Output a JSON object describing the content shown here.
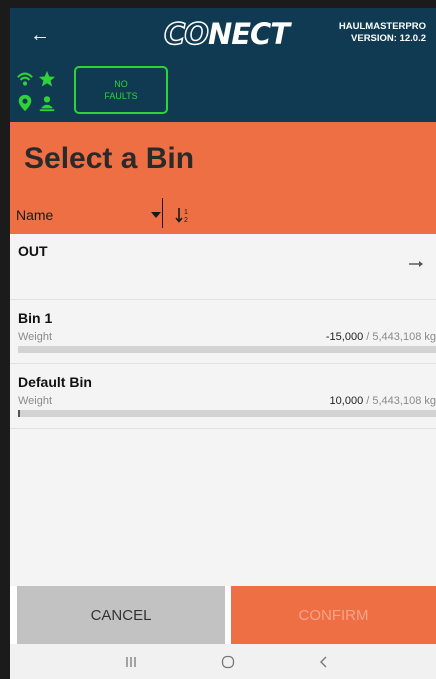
{
  "header": {
    "back_icon": "back-arrow-icon",
    "logo_prefix": "CO",
    "logo_suffix": "NECT",
    "app_name": "HAULMASTERPRO",
    "version": "VERSION: 12.0.2",
    "bg_color": "#103a52"
  },
  "status": {
    "icons": [
      "wifi-icon",
      "star-icon",
      "location-pin-icon",
      "person-icon"
    ],
    "icon_color": "#2fd238",
    "faults_label": "NO\nFAULTS"
  },
  "page": {
    "title": "Select a Bin",
    "accent_color": "#ef6f45"
  },
  "sort": {
    "field": "Name",
    "direction_icon": "sort-ascending-icon"
  },
  "bins": [
    {
      "name": "OUT",
      "action_icon": "arrow-right-icon"
    },
    {
      "name": "Bin 1",
      "weight_label": "Weight",
      "current": "-15,000",
      "capacity": "/ 5,443,108 kg",
      "fill_fraction": 0
    },
    {
      "name": "Default Bin",
      "weight_label": "Weight",
      "current": "10,000",
      "capacity": "/ 5,443,108 kg",
      "fill_fraction": 0.0018
    }
  ],
  "actions": {
    "cancel": "CANCEL",
    "confirm": "CONFIRM"
  },
  "navbar": {
    "icons": [
      "recent-apps-icon",
      "home-icon",
      "back-icon"
    ]
  }
}
